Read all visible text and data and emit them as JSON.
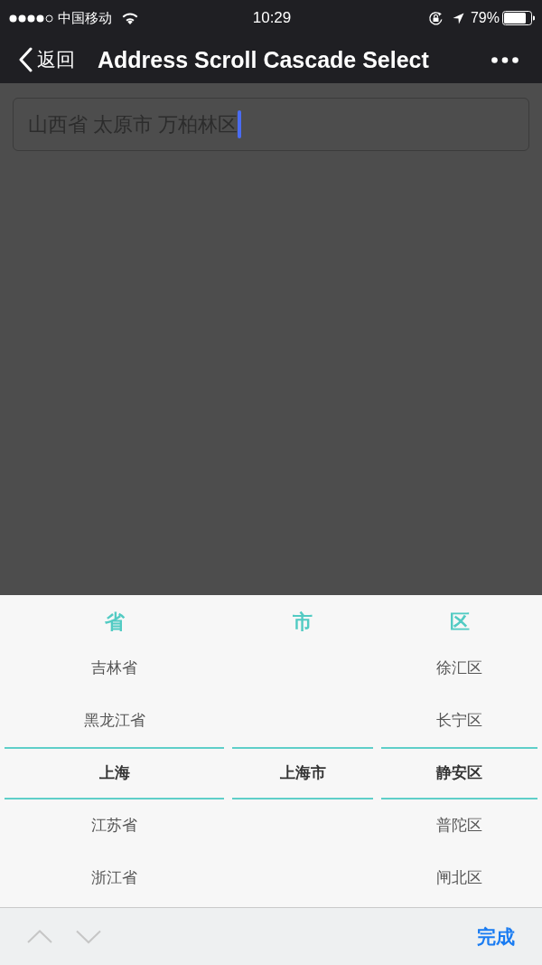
{
  "status_bar": {
    "carrier": "中国移动",
    "time": "10:29",
    "battery": "79%"
  },
  "nav_bar": {
    "back_label": "返回",
    "title": "Address Scroll Cascade Select"
  },
  "address_field": {
    "value": "山西省 太原市 万柏林区",
    "focused": true
  },
  "picker": {
    "columns": [
      {
        "header": "省",
        "items": [
          {
            "label": "吉林省",
            "selected": false
          },
          {
            "label": "黑龙江省",
            "selected": false
          },
          {
            "label": "上海",
            "selected": true
          },
          {
            "label": "江苏省",
            "selected": false
          },
          {
            "label": "浙江省",
            "selected": false
          }
        ]
      },
      {
        "header": "市",
        "items": [
          {
            "label": "上海市",
            "selected": true
          }
        ]
      },
      {
        "header": "区",
        "items": [
          {
            "label": "徐汇区",
            "selected": false
          },
          {
            "label": "长宁区",
            "selected": false
          },
          {
            "label": "静安区",
            "selected": true
          },
          {
            "label": "普陀区",
            "selected": false
          },
          {
            "label": "闸北区",
            "selected": false
          }
        ]
      }
    ]
  },
  "toolbar": {
    "nav_buttons": [
      {
        "kind": "previous",
        "disabled": true
      },
      {
        "kind": "next",
        "disabled": true
      }
    ],
    "done_label": "完成"
  }
}
